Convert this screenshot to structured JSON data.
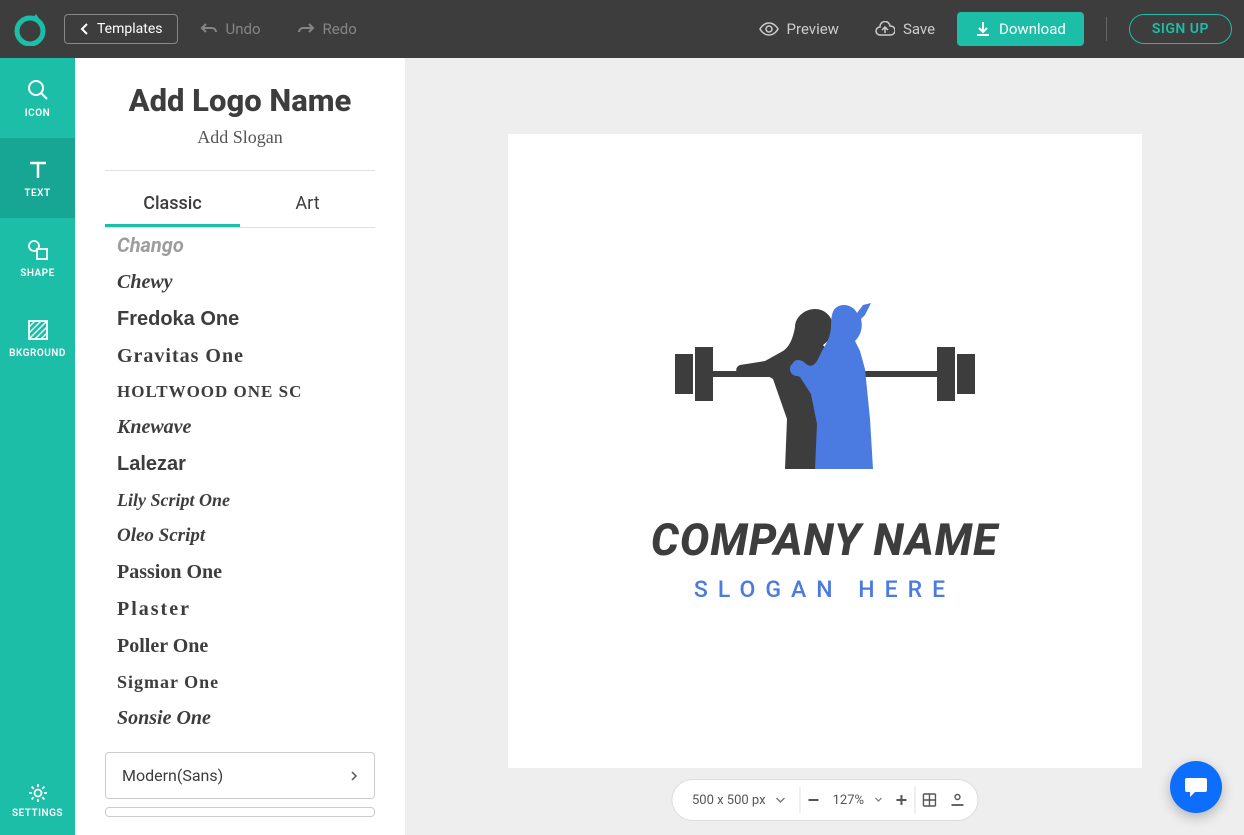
{
  "topbar": {
    "templates": "Templates",
    "undo": "Undo",
    "redo": "Redo",
    "preview": "Preview",
    "save": "Save",
    "download": "Download",
    "signup": "SIGN UP"
  },
  "nav": {
    "icon": "ICON",
    "text": "TEXT",
    "shape": "SHAPE",
    "bkground": "BKGROUND",
    "settings": "SETTINGS"
  },
  "panel": {
    "logoName": "Add Logo Name",
    "slogan": "Add Slogan",
    "tabs": {
      "classic": "Classic",
      "art": "Art"
    },
    "fonts": [
      "Chango",
      "Chewy",
      "Fredoka One",
      "Gravitas One",
      "HOLTWOOD ONE SC",
      "Knewave",
      "Lalezar",
      "Lily Script One",
      "Oleo Script",
      "Passion One",
      "Plaster",
      "Poller One",
      "Sigmar One",
      "Sonsie One"
    ],
    "category": "Modern(Sans)"
  },
  "canvas": {
    "companyName": "COMPANY NAME",
    "slogan": "SLOGAN HERE"
  },
  "toolbar": {
    "dimensions": "500 x 500 px",
    "zoom": "127%"
  }
}
